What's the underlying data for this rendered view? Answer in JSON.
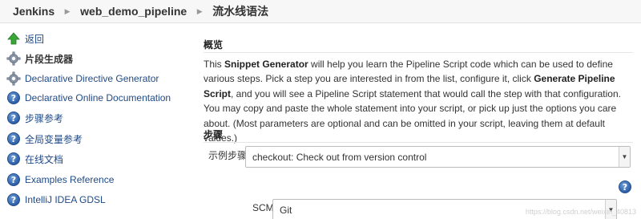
{
  "breadcrumb": {
    "items": [
      "Jenkins",
      "web_demo_pipeline",
      "流水线语法"
    ],
    "separator": "▶"
  },
  "sidebar": {
    "items": [
      {
        "label": "返回",
        "icon": "up-arrow-icon"
      },
      {
        "label": "片段生成器",
        "icon": "gear-icon",
        "active": true
      },
      {
        "label": "Declarative Directive Generator",
        "icon": "gear-icon"
      },
      {
        "label": "Declarative Online Documentation",
        "icon": "help-icon"
      },
      {
        "label": "步骤参考",
        "icon": "help-icon"
      },
      {
        "label": "全局变量参考",
        "icon": "help-icon"
      },
      {
        "label": "在线文档",
        "icon": "help-icon"
      },
      {
        "label": "Examples Reference",
        "icon": "help-icon"
      },
      {
        "label": "IntelliJ IDEA GDSL",
        "icon": "help-icon"
      }
    ]
  },
  "main": {
    "overview_title": "概览",
    "description": {
      "p1": "This ",
      "b1": "Snippet Generator",
      "p2": " will help you learn the Pipeline Script code which can be used to define various steps. Pick a step you are interested in from the list, configure it, click ",
      "b2": "Generate Pipeline Script",
      "p3": ", and you will see a Pipeline Script statement that would call the step with that configuration. You may copy and paste the whole statement into your script, or pick up just the options you care about. (Most parameters are optional and can be omitted in your script, leaving them at default values.)"
    },
    "steps_title": "步骤",
    "sample_step_label": "示例步骤",
    "sample_step_value": "checkout: Check out from version control",
    "scm_label": "SCM",
    "scm_value": "Git",
    "help_glyph": "?"
  },
  "watermark": "https://blog.csdn.net/weixin_40813"
}
